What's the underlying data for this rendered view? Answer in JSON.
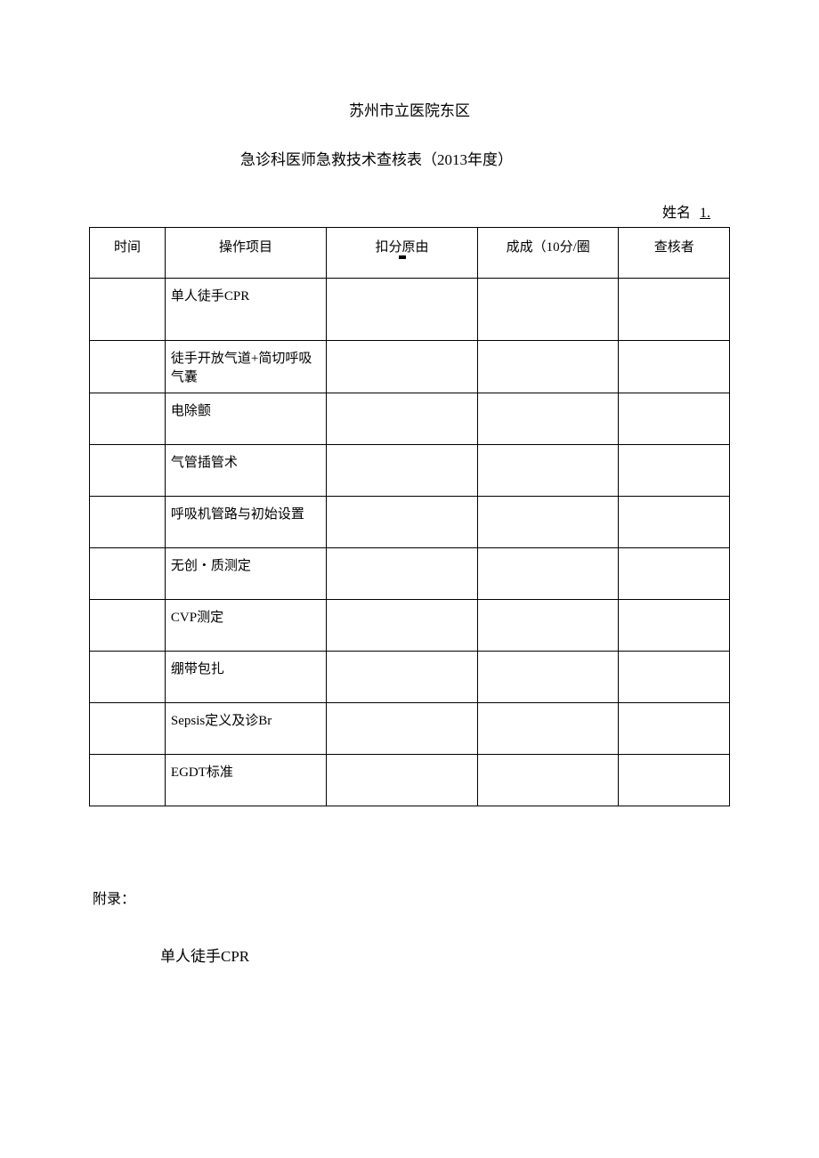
{
  "header": {
    "title1": "苏州市立医院东区",
    "title2": "急诊科医师急救技术查核表（2013年度）"
  },
  "name": {
    "label": "姓名",
    "value": "1."
  },
  "table": {
    "headers": {
      "time": "时间",
      "operation": "操作项目",
      "reason": "扣分原由",
      "score": "成成（10分/圈",
      "examiner": "查核者"
    },
    "rows": [
      {
        "time": "",
        "operation": "单人徒手CPR",
        "reason": "",
        "score": "",
        "examiner": ""
      },
      {
        "time": "",
        "operation": "徒手开放气道+简切呼吸气囊",
        "reason": "",
        "score": "",
        "examiner": ""
      },
      {
        "time": "",
        "operation": "电除颤",
        "reason": "",
        "score": "",
        "examiner": ""
      },
      {
        "time": "",
        "operation": "气管插管术",
        "reason": "",
        "score": "",
        "examiner": ""
      },
      {
        "time": "",
        "operation": "呼吸机管路与初始设置",
        "reason": "",
        "score": "",
        "examiner": ""
      },
      {
        "time": "",
        "operation": "无创・质测定",
        "reason": "",
        "score": "",
        "examiner": ""
      },
      {
        "time": "",
        "operation": "CVP测定",
        "reason": "",
        "score": "",
        "examiner": ""
      },
      {
        "time": "",
        "operation": "绷带包扎",
        "reason": "",
        "score": "",
        "examiner": ""
      },
      {
        "time": "",
        "operation": "Sepsis定义及诊Br",
        "reason": "",
        "score": "",
        "examiner": ""
      },
      {
        "time": "",
        "operation": "EGDT标准",
        "reason": "",
        "score": "",
        "examiner": ""
      }
    ]
  },
  "appendix": {
    "label": "附录：",
    "heading": "单人徒手CPR"
  }
}
